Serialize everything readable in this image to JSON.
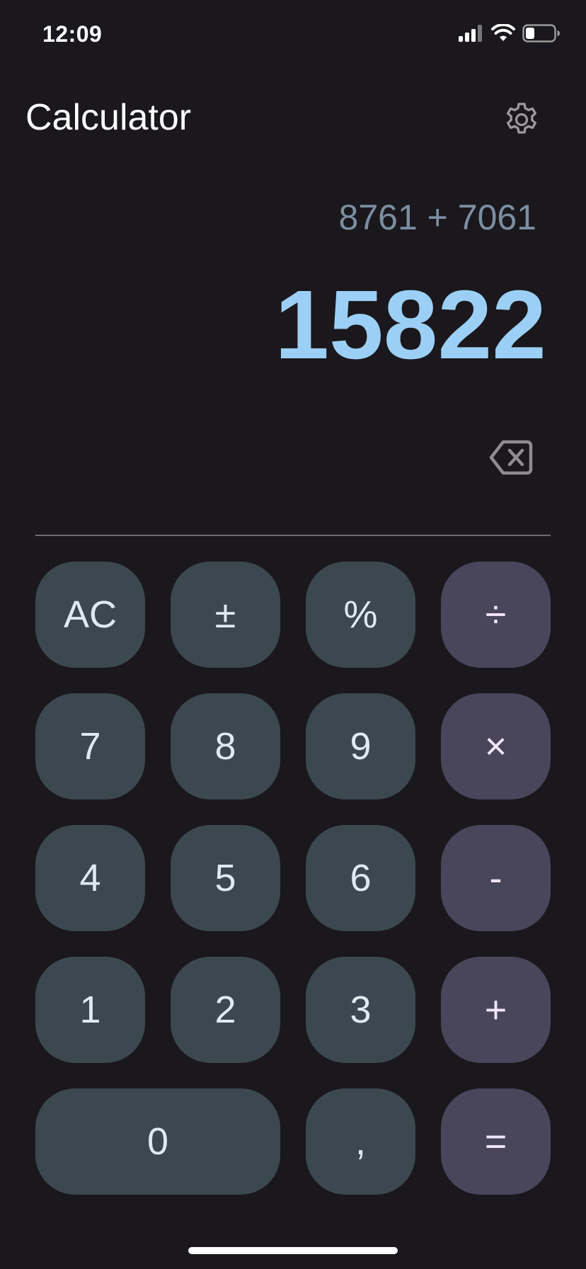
{
  "status_bar": {
    "time": "12:09",
    "icons": [
      "cellular-signal-icon",
      "wifi-icon",
      "battery-icon"
    ],
    "battery_level": 0.25
  },
  "header": {
    "title": "Calculator",
    "settings_icon": "gear-icon"
  },
  "display": {
    "expression": "8761 + 7061",
    "result": "15822",
    "backspace_icon": "backspace-icon"
  },
  "keypad": {
    "rows": [
      [
        "AC",
        "±",
        "%",
        "÷"
      ],
      [
        "7",
        "8",
        "9",
        "×"
      ],
      [
        "4",
        "5",
        "6",
        "-"
      ],
      [
        "1",
        "2",
        "3",
        "+"
      ],
      [
        "0",
        ",",
        "="
      ]
    ]
  },
  "colors": {
    "background": "#1a181c",
    "key_number": "#3c4850",
    "key_operator": "#49455b",
    "result_accent": "#9ccff5",
    "expression_text": "#7b8ea2"
  }
}
